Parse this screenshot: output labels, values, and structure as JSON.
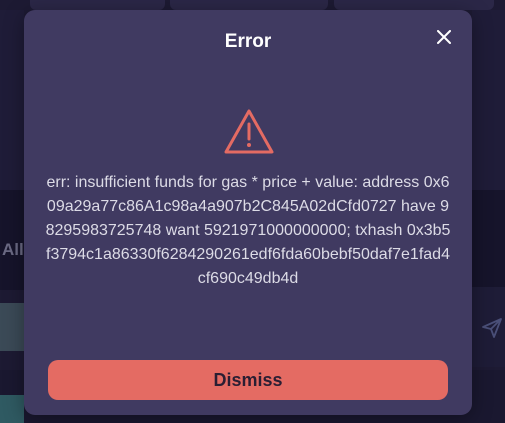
{
  "background": {
    "tab_label_fragment": "All"
  },
  "modal": {
    "title": "Error",
    "close_icon": "close-icon",
    "warning_icon": "warning-triangle-icon",
    "message": "err: insufficient funds for gas * price + value: address 0x609a29a77c86A1c98a4a907b2C845A02dCfd0727 have 98295983725748 want 5921971000000000; txhash 0x3b5f3794c1a86330f6284290261edf6fda60bebf50daf7e1fad4cf690c49db4d",
    "dismiss_label": "Dismiss",
    "colors": {
      "modal_bg": "#403a61",
      "accent": "#e46b63",
      "backdrop": "#1d1a33"
    }
  }
}
